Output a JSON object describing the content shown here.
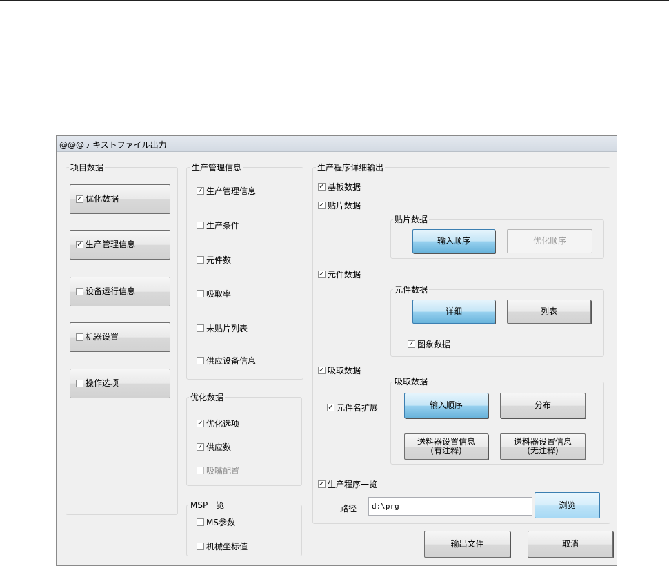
{
  "window": {
    "title": "@@@テキストファイル出力"
  },
  "project_data": {
    "title": "项目数据",
    "items": [
      {
        "label": "优化数据",
        "checked": true
      },
      {
        "label": "生产管理信息",
        "checked": true
      },
      {
        "label": "设备运行信息",
        "checked": false
      },
      {
        "label": "机器设置",
        "checked": false
      },
      {
        "label": "操作选项",
        "checked": false
      }
    ]
  },
  "production_mgmt": {
    "title": "生产管理信息",
    "items": [
      {
        "label": "生产管理信息",
        "checked": true
      },
      {
        "label": "生产条件",
        "checked": false
      },
      {
        "label": "元件数",
        "checked": false
      },
      {
        "label": "吸取率",
        "checked": false
      },
      {
        "label": "未贴片列表",
        "checked": false
      },
      {
        "label": "供应设备信息",
        "checked": false
      }
    ]
  },
  "optimization": {
    "title": "优化数据",
    "items": [
      {
        "label": "优化选项",
        "checked": true
      },
      {
        "label": "供应数",
        "checked": true
      },
      {
        "label": "吸嘴配置",
        "checked": false,
        "disabled": true
      }
    ]
  },
  "msp": {
    "title": "MSP一览",
    "items": [
      {
        "label": "MS参数",
        "checked": false
      },
      {
        "label": "机械坐标值",
        "checked": false
      }
    ]
  },
  "detail_output": {
    "title": "生产程序详细输出",
    "board_data": {
      "label": "基板数据",
      "checked": true
    },
    "placement_data": {
      "label": "贴片数据",
      "checked": true
    },
    "placement_group": {
      "title": "贴片数据",
      "input_order": "输入顺序",
      "optimized_order": "优化顺序"
    },
    "component_data": {
      "label": "元件数据",
      "checked": true
    },
    "component_group": {
      "title": "元件数据",
      "detail": "详细",
      "list": "列表",
      "image_data": {
        "label": "图象数据",
        "checked": true
      }
    },
    "pickup_data": {
      "label": "吸取数据",
      "checked": true
    },
    "name_extension": {
      "label": "元件名扩展",
      "checked": true
    },
    "pickup_group": {
      "title": "吸取数据",
      "input_order": "输入顺序",
      "distribution": "分布",
      "feeder_with_note": "送料器设置信息\n(有注释)",
      "feeder_without_note": "送料器设置信息\n(无注释)"
    },
    "program_list": {
      "label": "生产程序一览",
      "checked": true
    },
    "path": {
      "label": "路径",
      "value": "d:\\prg"
    },
    "browse": "浏览"
  },
  "footer": {
    "output_file": "输出文件",
    "cancel": "取消"
  },
  "check_mark": "✓"
}
